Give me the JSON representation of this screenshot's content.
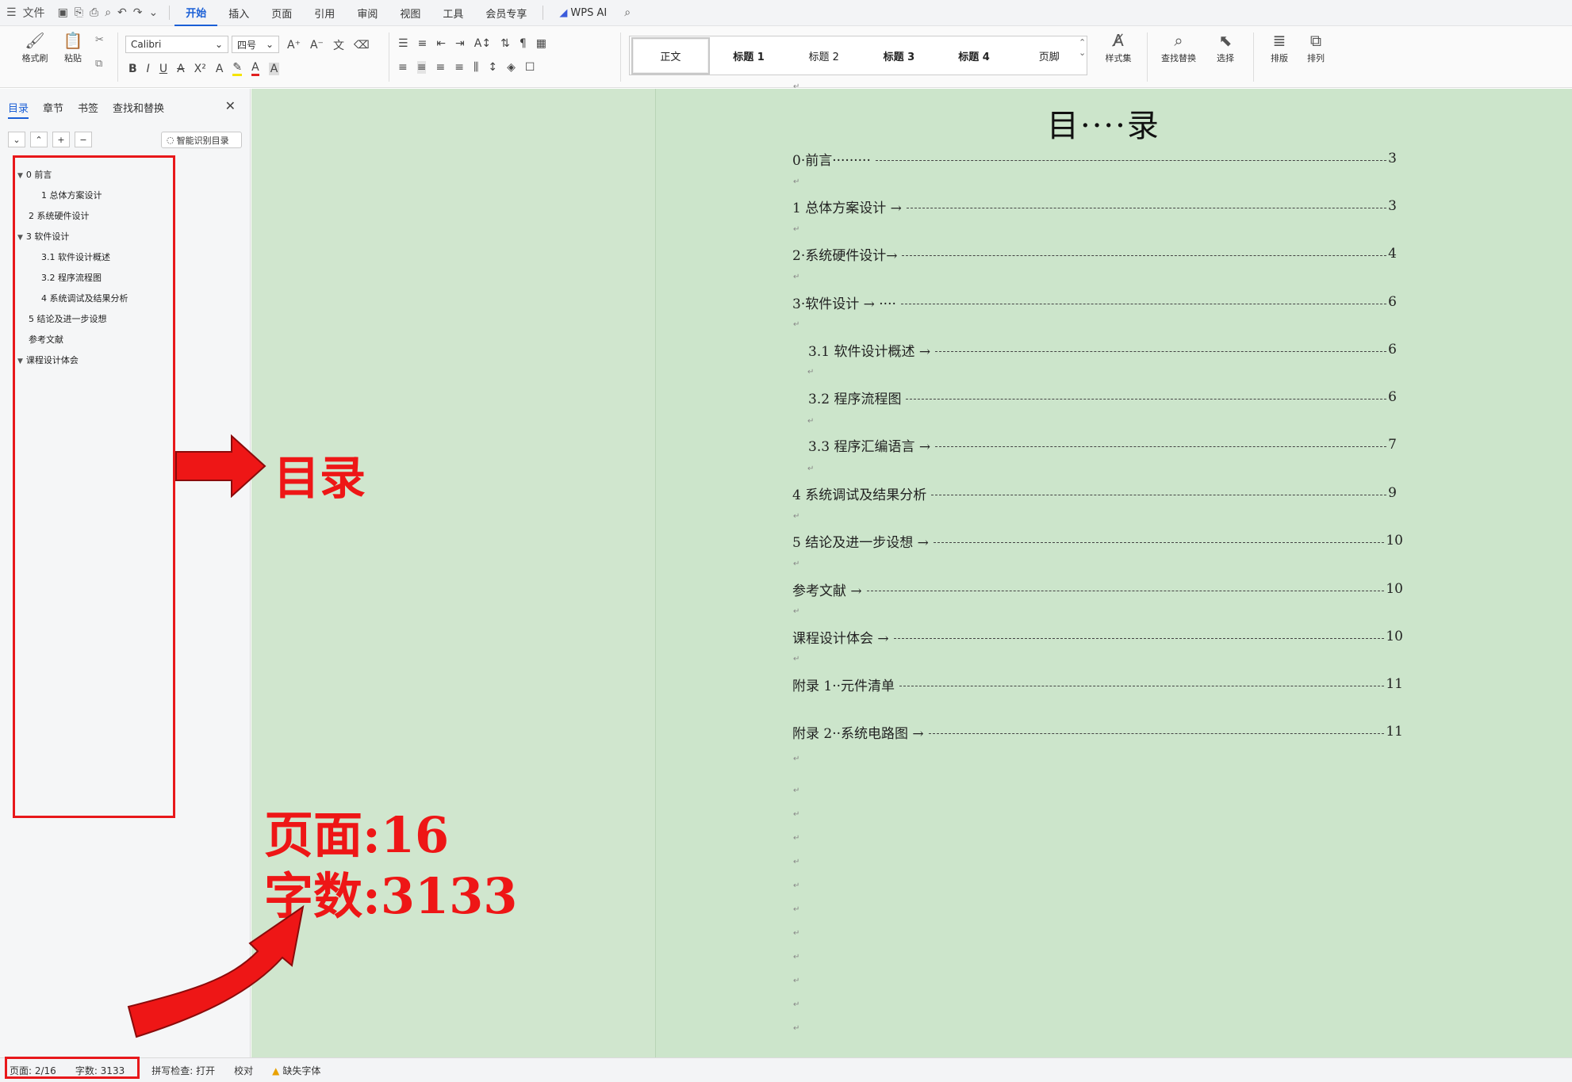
{
  "menubar": {
    "file_label": "文件",
    "tabs": [
      "开始",
      "插入",
      "页面",
      "引用",
      "审阅",
      "视图",
      "工具",
      "会员专享"
    ],
    "active_tab": "开始",
    "ai_label": "WPS AI"
  },
  "ribbon": {
    "format_painter": "格式刷",
    "paste": "粘贴",
    "font_name": "Calibri",
    "font_size": "四号",
    "styles": [
      "正文",
      "标题 1",
      "标题 2",
      "标题 3",
      "标题 4",
      "页脚"
    ],
    "style_set": "样式集",
    "find_replace": "查找替换",
    "select": "选择",
    "layout": "排版",
    "arrange": "排列"
  },
  "navpane": {
    "tabs": [
      "目录",
      "章节",
      "书签",
      "查找和替换"
    ],
    "active_tab": "目录",
    "smart_toc": "智能识别目录",
    "tree": [
      {
        "label": "0 前言",
        "level": 0,
        "expanded": true
      },
      {
        "label": "1 总体方案设计",
        "level": 1
      },
      {
        "label": "2 系统硬件设计",
        "level": 0
      },
      {
        "label": "3 软件设计",
        "level": 0,
        "expanded": true
      },
      {
        "label": "3.1 软件设计概述",
        "level": 1
      },
      {
        "label": "3.2 程序流程图",
        "level": 1
      },
      {
        "label": "4 系统调试及结果分析",
        "level": 1
      },
      {
        "label": "5 结论及进一步设想",
        "level": 0
      },
      {
        "label": "参考文献",
        "level": 0
      },
      {
        "label": "课程设计体会",
        "level": 0,
        "expanded": true
      }
    ]
  },
  "document": {
    "title": "目····录",
    "entries": [
      {
        "label": "0·前言·········",
        "page": "3",
        "indent": 0
      },
      {
        "label": "1 总体方案设计 →",
        "page": "3",
        "indent": 0
      },
      {
        "label": "2·系统硬件设计→",
        "page": "4",
        "indent": 0
      },
      {
        "label": "3·软件设计 → ····",
        "page": "6",
        "indent": 0
      },
      {
        "label": "3.1 软件设计概述 →",
        "page": "6",
        "indent": 1
      },
      {
        "label": "3.2 程序流程图",
        "page": "6",
        "indent": 1
      },
      {
        "label": "3.3 程序汇编语言 →",
        "page": "7",
        "indent": 1
      },
      {
        "label": "4 系统调试及结果分析",
        "page": "9",
        "indent": 0
      },
      {
        "label": "5 结论及进一步设想 →",
        "page": "10",
        "indent": 0
      },
      {
        "label": "参考文献 →",
        "page": "10",
        "indent": 0
      },
      {
        "label": "课程设计体会 →",
        "page": "10",
        "indent": 0
      },
      {
        "label": "附录 1··元件清单",
        "page": "11",
        "indent": 0
      },
      {
        "label": "附录 2··系统电路图 →",
        "page": "11",
        "indent": 0
      }
    ]
  },
  "annotations": {
    "toc_label": "目录",
    "pages_label": "页面:16",
    "words_label": "字数:3133",
    "color": "#ee1616"
  },
  "statusbar": {
    "page": "页面: 2/16",
    "words": "字数: 3133",
    "spellcheck": "拼写检查: 打开",
    "proofread": "校对",
    "missing_font": "缺失字体"
  }
}
